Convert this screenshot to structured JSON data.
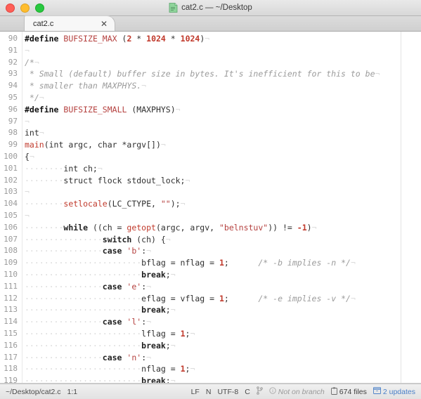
{
  "window": {
    "title": "cat2.c — ~/Desktop",
    "title_icon": "document-icon",
    "traffic_lights": [
      {
        "name": "close",
        "color": "#ff5f57"
      },
      {
        "name": "minimize",
        "color": "#ffbd2e"
      },
      {
        "name": "zoom",
        "color": "#28c840"
      }
    ]
  },
  "tabs": [
    {
      "label": "cat2.c",
      "close_glyph": "✕",
      "active": true
    }
  ],
  "editor": {
    "first_line": 90,
    "language": "C",
    "lines": [
      {
        "n": "90",
        "tokens": [
          {
            "t": "#define",
            "c": "pre"
          },
          {
            "t": " ",
            "c": "punct"
          },
          {
            "t": "BUFSIZE_MAX",
            "c": "macro"
          },
          {
            "t": " (",
            "c": "punct"
          },
          {
            "t": "2",
            "c": "num"
          },
          {
            "t": " * ",
            "c": "punct"
          },
          {
            "t": "1024",
            "c": "num"
          },
          {
            "t": " * ",
            "c": "punct"
          },
          {
            "t": "1024",
            "c": "num"
          },
          {
            "t": ")",
            "c": "punct"
          },
          {
            "t": "¬",
            "c": "eol"
          }
        ]
      },
      {
        "n": "91",
        "tokens": [
          {
            "t": "¬",
            "c": "eol"
          }
        ]
      },
      {
        "n": "92",
        "tokens": [
          {
            "t": "/*",
            "c": "cmt"
          },
          {
            "t": "¬",
            "c": "eol"
          }
        ]
      },
      {
        "n": "93",
        "tokens": [
          {
            "t": " * Small (default) buffer size in bytes. It's inefficient for this to be",
            "c": "cmt"
          },
          {
            "t": "¬",
            "c": "eol"
          }
        ]
      },
      {
        "n": "94",
        "tokens": [
          {
            "t": " * smaller than MAXPHYS.",
            "c": "cmt"
          },
          {
            "t": "¬",
            "c": "eol"
          }
        ]
      },
      {
        "n": "95",
        "tokens": [
          {
            "t": " */",
            "c": "cmt"
          },
          {
            "t": "¬",
            "c": "eol"
          }
        ]
      },
      {
        "n": "96",
        "tokens": [
          {
            "t": "#define",
            "c": "pre"
          },
          {
            "t": " ",
            "c": "punct"
          },
          {
            "t": "BUFSIZE_SMALL",
            "c": "macro"
          },
          {
            "t": " (MAXPHYS)",
            "c": "punct"
          },
          {
            "t": "¬",
            "c": "eol"
          }
        ]
      },
      {
        "n": "97",
        "tokens": [
          {
            "t": "¬",
            "c": "eol"
          }
        ]
      },
      {
        "n": "98",
        "tokens": [
          {
            "t": "int",
            "c": "punct"
          },
          {
            "t": "¬",
            "c": "eol"
          }
        ]
      },
      {
        "n": "99",
        "tokens": [
          {
            "t": "main",
            "c": "fn"
          },
          {
            "t": "(int argc, char *argv[])",
            "c": "punct"
          },
          {
            "t": "¬",
            "c": "eol"
          }
        ]
      },
      {
        "n": "100",
        "tokens": [
          {
            "t": "{",
            "c": "punct"
          },
          {
            "t": "¬",
            "c": "eol"
          }
        ]
      },
      {
        "n": "101",
        "tokens": [
          {
            "t": "········",
            "c": "ws"
          },
          {
            "t": "int ch;",
            "c": "punct"
          },
          {
            "t": "¬",
            "c": "eol"
          }
        ]
      },
      {
        "n": "102",
        "tokens": [
          {
            "t": "········",
            "c": "ws"
          },
          {
            "t": "struct flock stdout_lock;",
            "c": "punct"
          },
          {
            "t": "¬",
            "c": "eol"
          }
        ]
      },
      {
        "n": "103",
        "tokens": [
          {
            "t": "¬",
            "c": "eol"
          }
        ]
      },
      {
        "n": "104",
        "tokens": [
          {
            "t": "········",
            "c": "ws"
          },
          {
            "t": "setlocale",
            "c": "fn"
          },
          {
            "t": "(LC_CTYPE, ",
            "c": "punct"
          },
          {
            "t": "\"\"",
            "c": "str"
          },
          {
            "t": ");",
            "c": "punct"
          },
          {
            "t": "¬",
            "c": "eol"
          }
        ]
      },
      {
        "n": "105",
        "tokens": [
          {
            "t": "¬",
            "c": "eol"
          }
        ]
      },
      {
        "n": "106",
        "tokens": [
          {
            "t": "········",
            "c": "ws"
          },
          {
            "t": "while",
            "c": "kw"
          },
          {
            "t": " ((ch = ",
            "c": "punct"
          },
          {
            "t": "getopt",
            "c": "fn"
          },
          {
            "t": "(argc, argv, ",
            "c": "punct"
          },
          {
            "t": "\"belnstuv\"",
            "c": "str"
          },
          {
            "t": ")) != ",
            "c": "punct"
          },
          {
            "t": "-1",
            "c": "num"
          },
          {
            "t": ")",
            "c": "punct"
          },
          {
            "t": "¬",
            "c": "eol"
          }
        ]
      },
      {
        "n": "107",
        "tokens": [
          {
            "t": "················",
            "c": "ws"
          },
          {
            "t": "switch",
            "c": "kw"
          },
          {
            "t": " (ch) {",
            "c": "punct"
          },
          {
            "t": "¬",
            "c": "eol"
          }
        ]
      },
      {
        "n": "108",
        "tokens": [
          {
            "t": "················",
            "c": "ws"
          },
          {
            "t": "case",
            "c": "kw"
          },
          {
            "t": " ",
            "c": "punct"
          },
          {
            "t": "'b'",
            "c": "chr"
          },
          {
            "t": ":",
            "c": "punct"
          },
          {
            "t": "¬",
            "c": "eol"
          }
        ]
      },
      {
        "n": "109",
        "tokens": [
          {
            "t": "························",
            "c": "ws"
          },
          {
            "t": "bflag = nflag = ",
            "c": "punct"
          },
          {
            "t": "1",
            "c": "num"
          },
          {
            "t": ";",
            "c": "punct"
          },
          {
            "t": "      ",
            "c": "punct"
          },
          {
            "t": "/* -b implies -n */",
            "c": "cmt"
          },
          {
            "t": "¬",
            "c": "eol"
          }
        ]
      },
      {
        "n": "110",
        "tokens": [
          {
            "t": "························",
            "c": "ws"
          },
          {
            "t": "break",
            "c": "kw"
          },
          {
            "t": ";",
            "c": "punct"
          },
          {
            "t": "¬",
            "c": "eol"
          }
        ]
      },
      {
        "n": "111",
        "tokens": [
          {
            "t": "················",
            "c": "ws"
          },
          {
            "t": "case",
            "c": "kw"
          },
          {
            "t": " ",
            "c": "punct"
          },
          {
            "t": "'e'",
            "c": "chr"
          },
          {
            "t": ":",
            "c": "punct"
          },
          {
            "t": "¬",
            "c": "eol"
          }
        ]
      },
      {
        "n": "112",
        "tokens": [
          {
            "t": "························",
            "c": "ws"
          },
          {
            "t": "eflag = vflag = ",
            "c": "punct"
          },
          {
            "t": "1",
            "c": "num"
          },
          {
            "t": ";",
            "c": "punct"
          },
          {
            "t": "      ",
            "c": "punct"
          },
          {
            "t": "/* -e implies -v */",
            "c": "cmt"
          },
          {
            "t": "¬",
            "c": "eol"
          }
        ]
      },
      {
        "n": "113",
        "tokens": [
          {
            "t": "························",
            "c": "ws"
          },
          {
            "t": "break",
            "c": "kw"
          },
          {
            "t": ";",
            "c": "punct"
          },
          {
            "t": "¬",
            "c": "eol"
          }
        ]
      },
      {
        "n": "114",
        "tokens": [
          {
            "t": "················",
            "c": "ws"
          },
          {
            "t": "case",
            "c": "kw"
          },
          {
            "t": " ",
            "c": "punct"
          },
          {
            "t": "'l'",
            "c": "chr"
          },
          {
            "t": ":",
            "c": "punct"
          },
          {
            "t": "¬",
            "c": "eol"
          }
        ]
      },
      {
        "n": "115",
        "tokens": [
          {
            "t": "························",
            "c": "ws"
          },
          {
            "t": "lflag = ",
            "c": "punct"
          },
          {
            "t": "1",
            "c": "num"
          },
          {
            "t": ";",
            "c": "punct"
          },
          {
            "t": "¬",
            "c": "eol"
          }
        ]
      },
      {
        "n": "116",
        "tokens": [
          {
            "t": "························",
            "c": "ws"
          },
          {
            "t": "break",
            "c": "kw"
          },
          {
            "t": ";",
            "c": "punct"
          },
          {
            "t": "¬",
            "c": "eol"
          }
        ]
      },
      {
        "n": "117",
        "tokens": [
          {
            "t": "················",
            "c": "ws"
          },
          {
            "t": "case",
            "c": "kw"
          },
          {
            "t": " ",
            "c": "punct"
          },
          {
            "t": "'n'",
            "c": "chr"
          },
          {
            "t": ":",
            "c": "punct"
          },
          {
            "t": "¬",
            "c": "eol"
          }
        ]
      },
      {
        "n": "118",
        "tokens": [
          {
            "t": "························",
            "c": "ws"
          },
          {
            "t": "nflag = ",
            "c": "punct"
          },
          {
            "t": "1",
            "c": "num"
          },
          {
            "t": ";",
            "c": "punct"
          },
          {
            "t": "¬",
            "c": "eol"
          }
        ]
      },
      {
        "n": "119",
        "tokens": [
          {
            "t": "························",
            "c": "ws"
          },
          {
            "t": "break",
            "c": "kw"
          },
          {
            "t": ";",
            "c": "punct"
          },
          {
            "t": "¬",
            "c": "eol"
          }
        ]
      }
    ]
  },
  "statusbar": {
    "file_path": "~/Desktop/cat2.c",
    "cursor_position": "1:1",
    "line_ending": "LF",
    "indent": "N",
    "encoding": "UTF-8",
    "syntax": "C",
    "vcs_icon": "branch-icon",
    "branch_icon": "info-circle-icon",
    "branch_text": "Not on branch",
    "files_icon": "clipboard-icon",
    "files_text": "674 files",
    "updates_icon": "package-icon",
    "updates_text": "2 updates",
    "link_color": "#4a80c8"
  }
}
